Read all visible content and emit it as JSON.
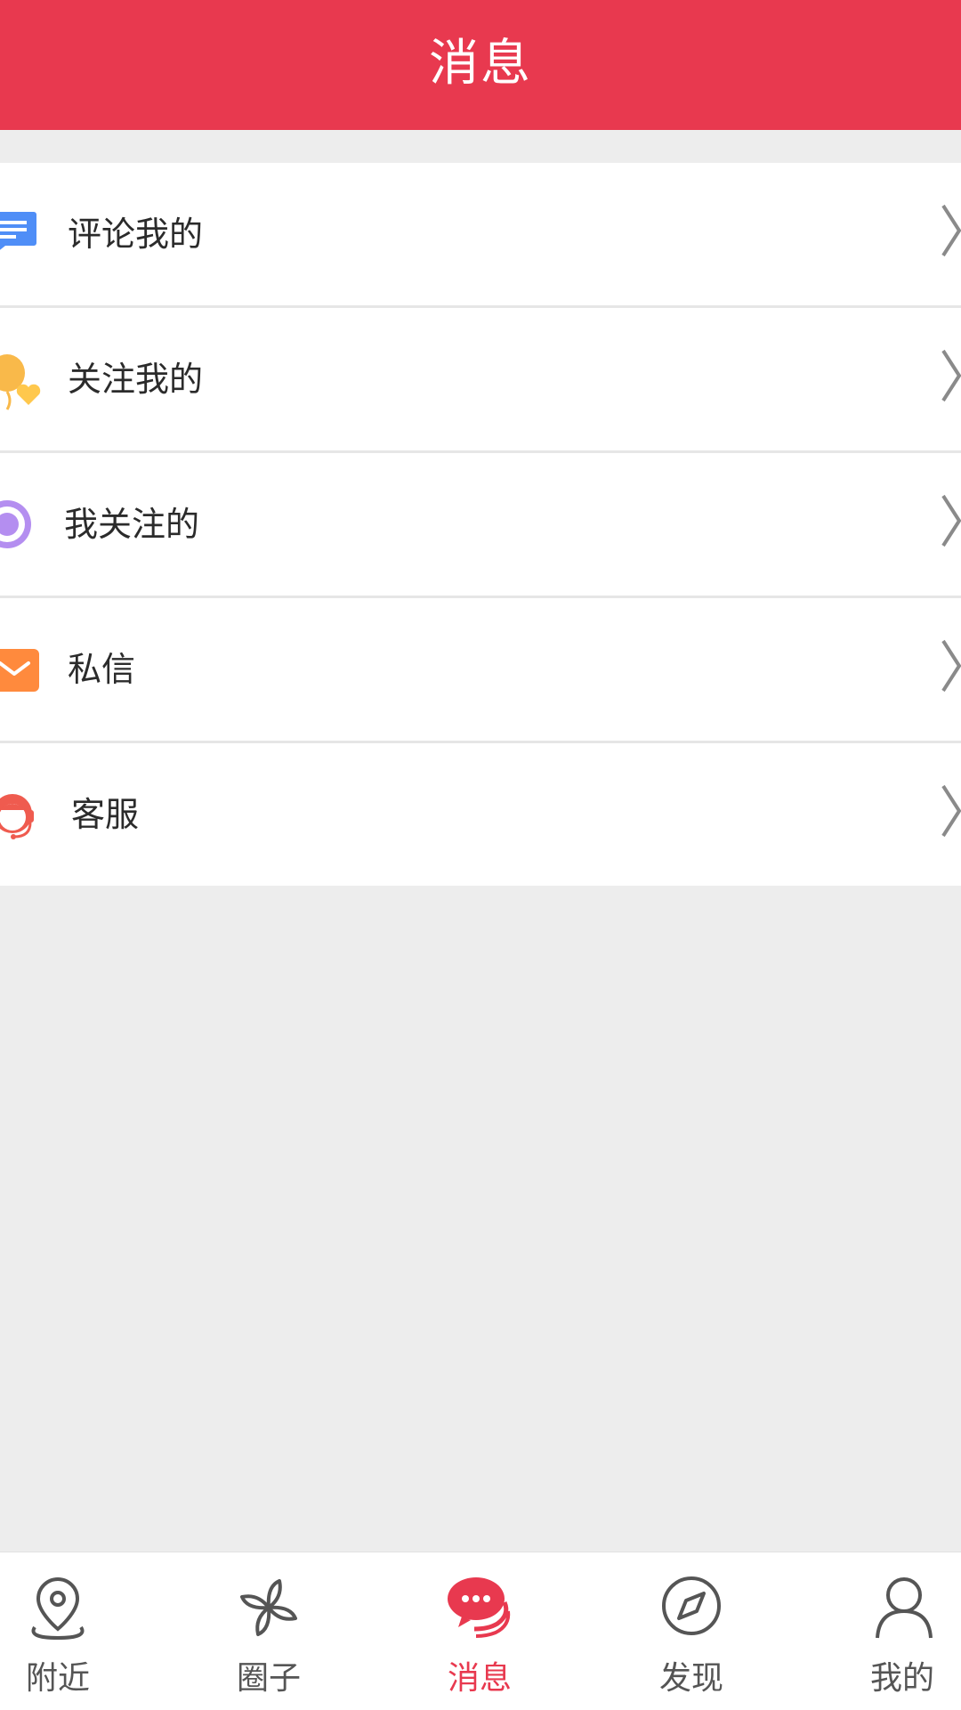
{
  "header": {
    "title": "消息"
  },
  "menu": {
    "items": [
      {
        "label": "评论我的",
        "icon": "comment-icon",
        "icon_color": "#4f8ef7"
      },
      {
        "label": "关注我的",
        "icon": "balloon-heart-icon",
        "icon_color": "#f9b94a"
      },
      {
        "label": "我关注的",
        "icon": "target-icon",
        "icon_color": "#b48ef0"
      },
      {
        "label": "私信",
        "icon": "mail-icon",
        "icon_color": "#ff8a3d"
      },
      {
        "label": "客服",
        "icon": "customer-service-icon",
        "icon_color": "#ef5b4f"
      }
    ]
  },
  "tabbar": {
    "tabs": [
      {
        "label": "附近",
        "icon": "location-pin-icon"
      },
      {
        "label": "圈子",
        "icon": "pinwheel-icon"
      },
      {
        "label": "消息",
        "icon": "chat-bubble-icon",
        "active": true
      },
      {
        "label": "发现",
        "icon": "compass-icon"
      },
      {
        "label": "我的",
        "icon": "user-icon"
      }
    ]
  },
  "colors": {
    "accent": "#e8394f",
    "background": "#ededed"
  }
}
